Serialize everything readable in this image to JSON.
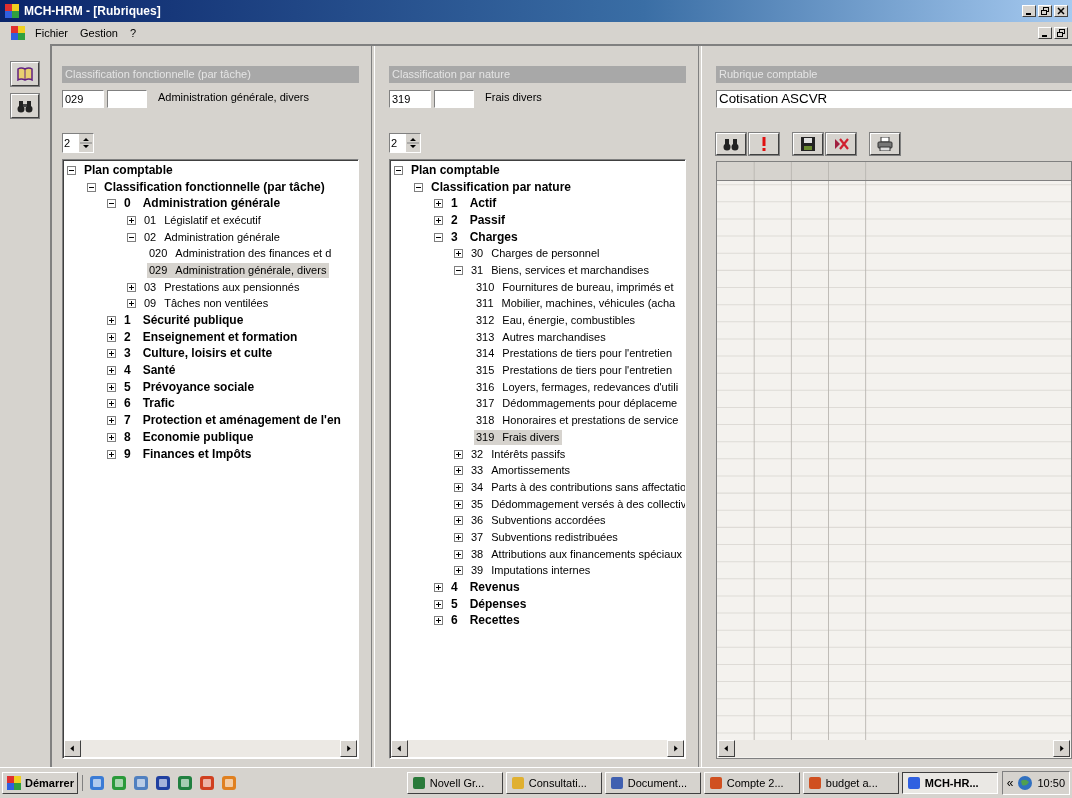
{
  "window": {
    "title": "MCH-HRM - [Rubriques]"
  },
  "menu": [
    "Fichier",
    "Gestion",
    "?"
  ],
  "panels": [
    {
      "header": "Classification fonctionnelle (par tâche)",
      "code": "029",
      "description": "Administration générale, divers",
      "spinner": "2",
      "tree": [
        {
          "label": "Plan comptable",
          "kind": "heading",
          "expanded": true,
          "selected": false,
          "children": [
            {
              "label": "Classification fonctionnelle (par tâche)",
              "kind": "heading",
              "expanded": true,
              "selected": false,
              "children": [
                {
                  "code": "0",
                  "label": "Administration générale",
                  "kind": "heading",
                  "expanded": true,
                  "selected": false,
                  "children": [
                    {
                      "code": "01",
                      "label": "Législatif et exécutif",
                      "kind": "item",
                      "expanded": false,
                      "selected": false
                    },
                    {
                      "code": "02",
                      "label": "Administration générale",
                      "kind": "item",
                      "expanded": true,
                      "selected": false,
                      "children": [
                        {
                          "code": "020",
                          "label": "Administration des finances et d",
                          "kind": "item",
                          "selected": false
                        },
                        {
                          "code": "029",
                          "label": "Administration générale, divers",
                          "kind": "item",
                          "selected": true
                        }
                      ]
                    },
                    {
                      "code": "03",
                      "label": "Prestations aux pensionnés",
                      "kind": "item",
                      "expanded": false,
                      "selected": false
                    },
                    {
                      "code": "09",
                      "label": "Tâches non ventilées",
                      "kind": "item",
                      "expanded": false,
                      "selected": false
                    }
                  ]
                },
                {
                  "code": "1",
                  "label": "Sécurité publique",
                  "kind": "heading",
                  "expanded": false,
                  "selected": false
                },
                {
                  "code": "2",
                  "label": "Enseignement et formation",
                  "kind": "heading",
                  "expanded": false,
                  "selected": false
                },
                {
                  "code": "3",
                  "label": "Culture, loisirs et culte",
                  "kind": "heading",
                  "expanded": false,
                  "selected": false
                },
                {
                  "code": "4",
                  "label": "Santé",
                  "kind": "heading",
                  "expanded": false,
                  "selected": false
                },
                {
                  "code": "5",
                  "label": "Prévoyance sociale",
                  "kind": "heading",
                  "expanded": false,
                  "selected": false
                },
                {
                  "code": "6",
                  "label": "Trafic",
                  "kind": "heading",
                  "expanded": false,
                  "selected": false
                },
                {
                  "code": "7",
                  "label": "Protection et aménagement de l'en",
                  "kind": "heading",
                  "expanded": false,
                  "selected": false
                },
                {
                  "code": "8",
                  "label": "Economie publique",
                  "kind": "heading",
                  "expanded": false,
                  "selected": false
                },
                {
                  "code": "9",
                  "label": "Finances et Impôts",
                  "kind": "heading",
                  "expanded": false,
                  "selected": false
                }
              ]
            }
          ]
        }
      ]
    },
    {
      "header": "Classification par nature",
      "code": "319",
      "description": "Frais divers",
      "spinner": "2",
      "tree": [
        {
          "label": "Plan comptable",
          "kind": "heading",
          "expanded": true,
          "selected": false,
          "children": [
            {
              "label": "Classification par nature",
              "kind": "heading",
              "expanded": true,
              "selected": false,
              "children": [
                {
                  "code": "1",
                  "label": "Actif",
                  "kind": "heading",
                  "expanded": false,
                  "selected": false
                },
                {
                  "code": "2",
                  "label": "Passif",
                  "kind": "heading",
                  "expanded": false,
                  "selected": false
                },
                {
                  "code": "3",
                  "label": "Charges",
                  "kind": "heading",
                  "expanded": true,
                  "selected": false,
                  "children": [
                    {
                      "code": "30",
                      "label": "Charges de personnel",
                      "kind": "item",
                      "expanded": false,
                      "selected": false
                    },
                    {
                      "code": "31",
                      "label": "Biens, services et marchandises",
                      "kind": "item",
                      "expanded": true,
                      "selected": false,
                      "children": [
                        {
                          "code": "310",
                          "label": "Fournitures de bureau, imprimés et",
                          "kind": "item",
                          "selected": false
                        },
                        {
                          "code": "311",
                          "label": "Mobilier, machines, véhicules (acha",
                          "kind": "item",
                          "selected": false
                        },
                        {
                          "code": "312",
                          "label": "Eau, énergie, combustibles",
                          "kind": "item",
                          "selected": false
                        },
                        {
                          "code": "313",
                          "label": "Autres marchandises",
                          "kind": "item",
                          "selected": false
                        },
                        {
                          "code": "314",
                          "label": "Prestations de tiers pour l'entretien",
                          "kind": "item",
                          "selected": false
                        },
                        {
                          "code": "315",
                          "label": "Prestations de tiers pour l'entretien",
                          "kind": "item",
                          "selected": false
                        },
                        {
                          "code": "316",
                          "label": "Loyers, fermages, redevances d'utili",
                          "kind": "item",
                          "selected": false
                        },
                        {
                          "code": "317",
                          "label": "Dédommagements pour déplaceme",
                          "kind": "item",
                          "selected": false
                        },
                        {
                          "code": "318",
                          "label": "Honoraires et prestations de service",
                          "kind": "item",
                          "selected": false
                        },
                        {
                          "code": "319",
                          "label": "Frais divers",
                          "kind": "item",
                          "selected": true
                        }
                      ]
                    },
                    {
                      "code": "32",
                      "label": "Intérêts passifs",
                      "kind": "item",
                      "expanded": false,
                      "selected": false
                    },
                    {
                      "code": "33",
                      "label": "Amortissements",
                      "kind": "item",
                      "expanded": false,
                      "selected": false
                    },
                    {
                      "code": "34",
                      "label": "Parts à des contributions sans affectatio",
                      "kind": "item",
                      "expanded": false,
                      "selected": false
                    },
                    {
                      "code": "35",
                      "label": "Dédommagement versés à des collectiv",
                      "kind": "item",
                      "expanded": false,
                      "selected": false
                    },
                    {
                      "code": "36",
                      "label": "Subventions accordées",
                      "kind": "item",
                      "expanded": false,
                      "selected": false
                    },
                    {
                      "code": "37",
                      "label": "Subventions redistribuées",
                      "kind": "item",
                      "expanded": false,
                      "selected": false
                    },
                    {
                      "code": "38",
                      "label": "Attributions aux financements spéciaux",
                      "kind": "item",
                      "expanded": false,
                      "selected": false
                    },
                    {
                      "code": "39",
                      "label": "Imputations internes",
                      "kind": "item",
                      "expanded": false,
                      "selected": false
                    }
                  ]
                },
                {
                  "code": "4",
                  "label": "Revenus",
                  "kind": "heading",
                  "expanded": false,
                  "selected": false
                },
                {
                  "code": "5",
                  "label": "Dépenses",
                  "kind": "heading",
                  "expanded": false,
                  "selected": false
                },
                {
                  "code": "6",
                  "label": "Recettes",
                  "kind": "heading",
                  "expanded": false,
                  "selected": false
                }
              ]
            }
          ]
        }
      ]
    }
  ],
  "record": {
    "header": "Rubrique comptable",
    "name": "Cotisation ASCVR"
  },
  "taskbar": {
    "start": "Démarrer",
    "tasks": [
      {
        "label": "Novell Gr...",
        "selected": false
      },
      {
        "label": "Consultati...",
        "selected": false
      },
      {
        "label": "Document...",
        "selected": false
      },
      {
        "label": "Compte 2...",
        "selected": false
      },
      {
        "label": "budget a...",
        "selected": false
      },
      {
        "label": "MCH-HR...",
        "selected": true
      }
    ],
    "tray_toggle": "«",
    "clock": "10:50"
  }
}
